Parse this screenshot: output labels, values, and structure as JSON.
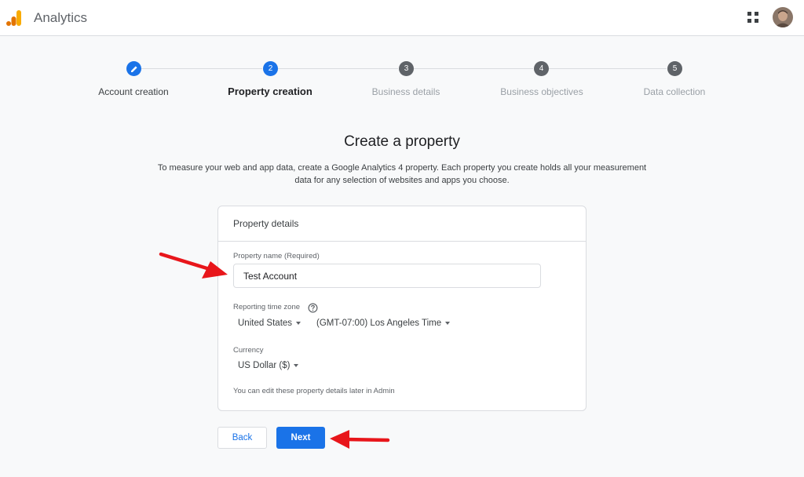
{
  "header": {
    "app_title": "Analytics",
    "icons": {
      "logo": "analytics-logo-icon",
      "apps": "apps-grid-icon",
      "avatar": "user-avatar"
    }
  },
  "stepper": {
    "steps": [
      {
        "number": "",
        "label": "Account creation",
        "state": "completed"
      },
      {
        "number": "2",
        "label": "Property creation",
        "state": "current"
      },
      {
        "number": "3",
        "label": "Business details",
        "state": "upcoming"
      },
      {
        "number": "4",
        "label": "Business objectives",
        "state": "upcoming"
      },
      {
        "number": "5",
        "label": "Data collection",
        "state": "upcoming"
      }
    ]
  },
  "main": {
    "title": "Create a property",
    "description": "To measure your web and app data, create a Google Analytics 4 property. Each property you create holds all your measurement data for any selection of websites and apps you choose."
  },
  "card": {
    "title": "Property details",
    "property_name_label": "Property name (Required)",
    "property_name_value": "Test Account",
    "timezone_label": "Reporting time zone",
    "country_value": "United States",
    "timezone_value": "(GMT-07:00) Los Angeles Time",
    "currency_label": "Currency",
    "currency_value": "US Dollar ($)",
    "hint": "You can edit these property details later in Admin"
  },
  "actions": {
    "back_label": "Back",
    "next_label": "Next"
  },
  "colors": {
    "accent": "#1a73e8",
    "step_inactive": "#5f6368",
    "annotation_arrow": "#e8161b",
    "logo_orange": "#f9ab00",
    "logo_dark_orange": "#e37400"
  }
}
